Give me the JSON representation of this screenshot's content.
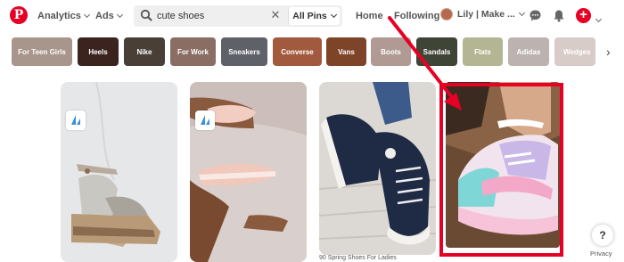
{
  "topbar": {
    "analytics": "Analytics",
    "ads": "Ads",
    "search_value": "cute shoes",
    "search_scope": "All Pins",
    "home": "Home",
    "following": "Following",
    "user_name": "Lily | Make ..."
  },
  "chips": [
    {
      "label": "For Teen Girls",
      "color": "#a8958c"
    },
    {
      "label": "Heels",
      "color": "#3b241d"
    },
    {
      "label": "Nike",
      "color": "#4a3f37"
    },
    {
      "label": "For Work",
      "color": "#8a6e64"
    },
    {
      "label": "Sneakers",
      "color": "#5e6167"
    },
    {
      "label": "Converse",
      "color": "#a25a3e"
    },
    {
      "label": "Vans",
      "color": "#7e4428"
    },
    {
      "label": "Boots",
      "color": "#b09a93"
    },
    {
      "label": "Sandals",
      "color": "#3f4536"
    },
    {
      "label": "Flats",
      "color": "#b3b593"
    },
    {
      "label": "Adidas",
      "color": "#bcb2b0"
    },
    {
      "label": "Wedges",
      "color": "#d8ccc8"
    }
  ],
  "pins": {
    "caption": "90 Spring Shoes For Ladies"
  },
  "help": "?",
  "privacy": "Privacy"
}
